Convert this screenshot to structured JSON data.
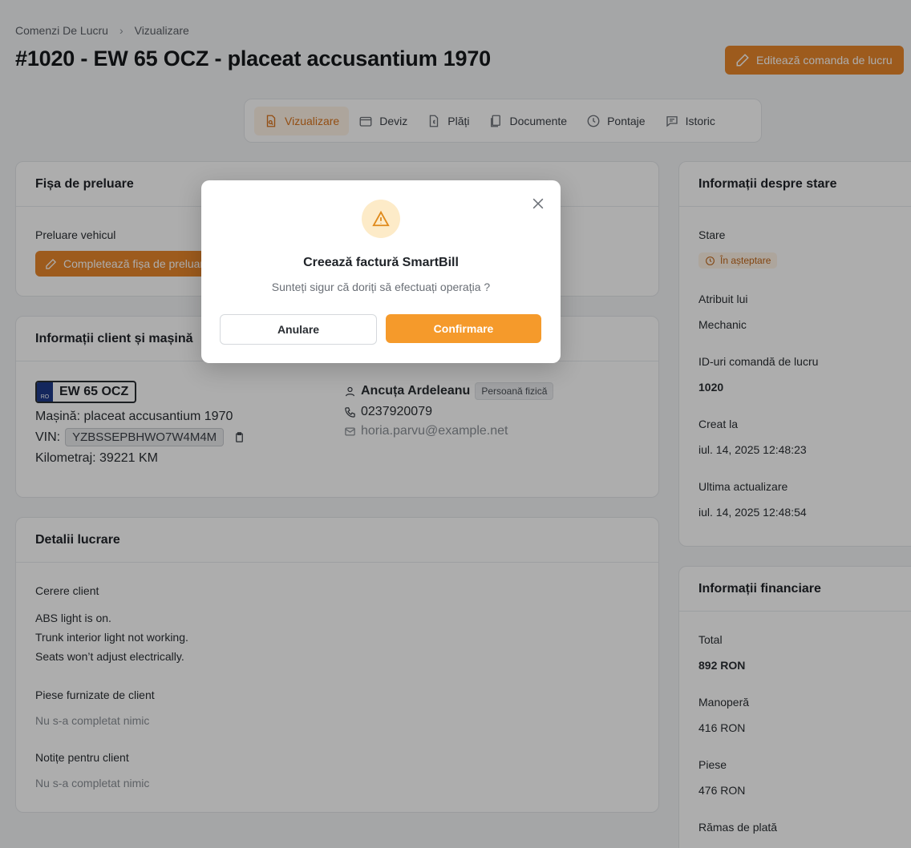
{
  "breadcrumb": {
    "root": "Comenzi De Lucru",
    "separator": "›",
    "current": "Vizualizare"
  },
  "page_title": "#1020 - EW 65 OCZ - placeat accusantium 1970",
  "edit_button": "Editează comanda de lucru",
  "tabs": [
    {
      "label": "Vizualizare",
      "icon": "file-search-icon"
    },
    {
      "label": "Deviz",
      "icon": "wallet-icon"
    },
    {
      "label": "Plăți",
      "icon": "euro-file-icon"
    },
    {
      "label": "Documente",
      "icon": "documents-icon"
    },
    {
      "label": "Pontaje",
      "icon": "clock-icon"
    },
    {
      "label": "Istoric",
      "icon": "message-icon"
    }
  ],
  "intake": {
    "title": "Fișa de preluare",
    "label": "Preluare vehicul",
    "button": "Completează fișa de preluare"
  },
  "client_car": {
    "title": "Informații client și mașină",
    "plate_country": "RO",
    "plate": "EW 65 OCZ",
    "car": "Mașină: placeat accusantium 1970",
    "vin_label": "VIN:",
    "vin": "YZBSSEPBHWO7W4M4M",
    "km": "Kilometraj: 39221 KM",
    "client_name": "Ancuța Ardeleanu",
    "client_type": "Persoană fizică",
    "phone": "0237920079",
    "email": "horia.parvu@example.net"
  },
  "work": {
    "title": "Detalii lucrare",
    "request_label": "Cerere client",
    "request_lines": [
      "ABS light is on.",
      "Trunk interior light not working.",
      "Seats won’t adjust electrically."
    ],
    "parts_label": "Piese furnizate de client",
    "parts_value": "Nu s-a completat nimic",
    "notes_label": "Notițe pentru client",
    "notes_value": "Nu s-a completat nimic"
  },
  "status": {
    "title": "Informații despre stare",
    "state_label": "Stare",
    "state_value": "În așteptare",
    "assigned_label": "Atribuit lui",
    "assigned_value": "Mechanic",
    "id_label": "ID-uri comandă de lucru",
    "id_value": "1020",
    "created_label": "Creat la",
    "created_value": "iul. 14, 2025 12:48:23",
    "updated_label": "Ultima actualizare",
    "updated_value": "iul. 14, 2025 12:48:54"
  },
  "finance": {
    "title": "Informații financiare",
    "total_label": "Total",
    "total_value": "892 RON",
    "labor_label": "Manoperă",
    "labor_value": "416 RON",
    "parts_label": "Piese",
    "parts_value": "476 RON",
    "remaining_label": "Rămas de plată"
  },
  "modal": {
    "title": "Creează factură SmartBill",
    "text": "Sunteți sigur că doriți să efectuați operația ?",
    "cancel": "Anulare",
    "confirm": "Confirmare"
  },
  "colors": {
    "accent": "#e8862b",
    "confirm": "#f59a2b",
    "warning_bg": "#fdebc8",
    "warning_icon": "#e08a1c"
  }
}
